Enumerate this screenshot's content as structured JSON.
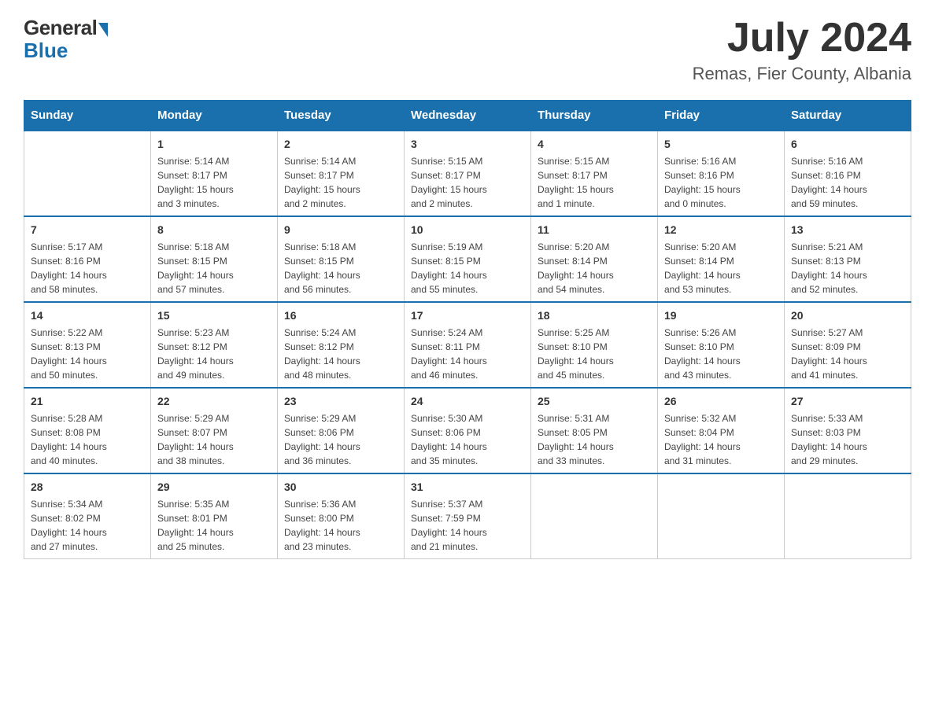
{
  "logo": {
    "general": "General",
    "blue": "Blue"
  },
  "title": {
    "month_year": "July 2024",
    "location": "Remas, Fier County, Albania"
  },
  "days_of_week": [
    "Sunday",
    "Monday",
    "Tuesday",
    "Wednesday",
    "Thursday",
    "Friday",
    "Saturday"
  ],
  "weeks": [
    [
      {
        "day": "",
        "info": ""
      },
      {
        "day": "1",
        "info": "Sunrise: 5:14 AM\nSunset: 8:17 PM\nDaylight: 15 hours\nand 3 minutes."
      },
      {
        "day": "2",
        "info": "Sunrise: 5:14 AM\nSunset: 8:17 PM\nDaylight: 15 hours\nand 2 minutes."
      },
      {
        "day": "3",
        "info": "Sunrise: 5:15 AM\nSunset: 8:17 PM\nDaylight: 15 hours\nand 2 minutes."
      },
      {
        "day": "4",
        "info": "Sunrise: 5:15 AM\nSunset: 8:17 PM\nDaylight: 15 hours\nand 1 minute."
      },
      {
        "day": "5",
        "info": "Sunrise: 5:16 AM\nSunset: 8:16 PM\nDaylight: 15 hours\nand 0 minutes."
      },
      {
        "day": "6",
        "info": "Sunrise: 5:16 AM\nSunset: 8:16 PM\nDaylight: 14 hours\nand 59 minutes."
      }
    ],
    [
      {
        "day": "7",
        "info": "Sunrise: 5:17 AM\nSunset: 8:16 PM\nDaylight: 14 hours\nand 58 minutes."
      },
      {
        "day": "8",
        "info": "Sunrise: 5:18 AM\nSunset: 8:15 PM\nDaylight: 14 hours\nand 57 minutes."
      },
      {
        "day": "9",
        "info": "Sunrise: 5:18 AM\nSunset: 8:15 PM\nDaylight: 14 hours\nand 56 minutes."
      },
      {
        "day": "10",
        "info": "Sunrise: 5:19 AM\nSunset: 8:15 PM\nDaylight: 14 hours\nand 55 minutes."
      },
      {
        "day": "11",
        "info": "Sunrise: 5:20 AM\nSunset: 8:14 PM\nDaylight: 14 hours\nand 54 minutes."
      },
      {
        "day": "12",
        "info": "Sunrise: 5:20 AM\nSunset: 8:14 PM\nDaylight: 14 hours\nand 53 minutes."
      },
      {
        "day": "13",
        "info": "Sunrise: 5:21 AM\nSunset: 8:13 PM\nDaylight: 14 hours\nand 52 minutes."
      }
    ],
    [
      {
        "day": "14",
        "info": "Sunrise: 5:22 AM\nSunset: 8:13 PM\nDaylight: 14 hours\nand 50 minutes."
      },
      {
        "day": "15",
        "info": "Sunrise: 5:23 AM\nSunset: 8:12 PM\nDaylight: 14 hours\nand 49 minutes."
      },
      {
        "day": "16",
        "info": "Sunrise: 5:24 AM\nSunset: 8:12 PM\nDaylight: 14 hours\nand 48 minutes."
      },
      {
        "day": "17",
        "info": "Sunrise: 5:24 AM\nSunset: 8:11 PM\nDaylight: 14 hours\nand 46 minutes."
      },
      {
        "day": "18",
        "info": "Sunrise: 5:25 AM\nSunset: 8:10 PM\nDaylight: 14 hours\nand 45 minutes."
      },
      {
        "day": "19",
        "info": "Sunrise: 5:26 AM\nSunset: 8:10 PM\nDaylight: 14 hours\nand 43 minutes."
      },
      {
        "day": "20",
        "info": "Sunrise: 5:27 AM\nSunset: 8:09 PM\nDaylight: 14 hours\nand 41 minutes."
      }
    ],
    [
      {
        "day": "21",
        "info": "Sunrise: 5:28 AM\nSunset: 8:08 PM\nDaylight: 14 hours\nand 40 minutes."
      },
      {
        "day": "22",
        "info": "Sunrise: 5:29 AM\nSunset: 8:07 PM\nDaylight: 14 hours\nand 38 minutes."
      },
      {
        "day": "23",
        "info": "Sunrise: 5:29 AM\nSunset: 8:06 PM\nDaylight: 14 hours\nand 36 minutes."
      },
      {
        "day": "24",
        "info": "Sunrise: 5:30 AM\nSunset: 8:06 PM\nDaylight: 14 hours\nand 35 minutes."
      },
      {
        "day": "25",
        "info": "Sunrise: 5:31 AM\nSunset: 8:05 PM\nDaylight: 14 hours\nand 33 minutes."
      },
      {
        "day": "26",
        "info": "Sunrise: 5:32 AM\nSunset: 8:04 PM\nDaylight: 14 hours\nand 31 minutes."
      },
      {
        "day": "27",
        "info": "Sunrise: 5:33 AM\nSunset: 8:03 PM\nDaylight: 14 hours\nand 29 minutes."
      }
    ],
    [
      {
        "day": "28",
        "info": "Sunrise: 5:34 AM\nSunset: 8:02 PM\nDaylight: 14 hours\nand 27 minutes."
      },
      {
        "day": "29",
        "info": "Sunrise: 5:35 AM\nSunset: 8:01 PM\nDaylight: 14 hours\nand 25 minutes."
      },
      {
        "day": "30",
        "info": "Sunrise: 5:36 AM\nSunset: 8:00 PM\nDaylight: 14 hours\nand 23 minutes."
      },
      {
        "day": "31",
        "info": "Sunrise: 5:37 AM\nSunset: 7:59 PM\nDaylight: 14 hours\nand 21 minutes."
      },
      {
        "day": "",
        "info": ""
      },
      {
        "day": "",
        "info": ""
      },
      {
        "day": "",
        "info": ""
      }
    ]
  ]
}
